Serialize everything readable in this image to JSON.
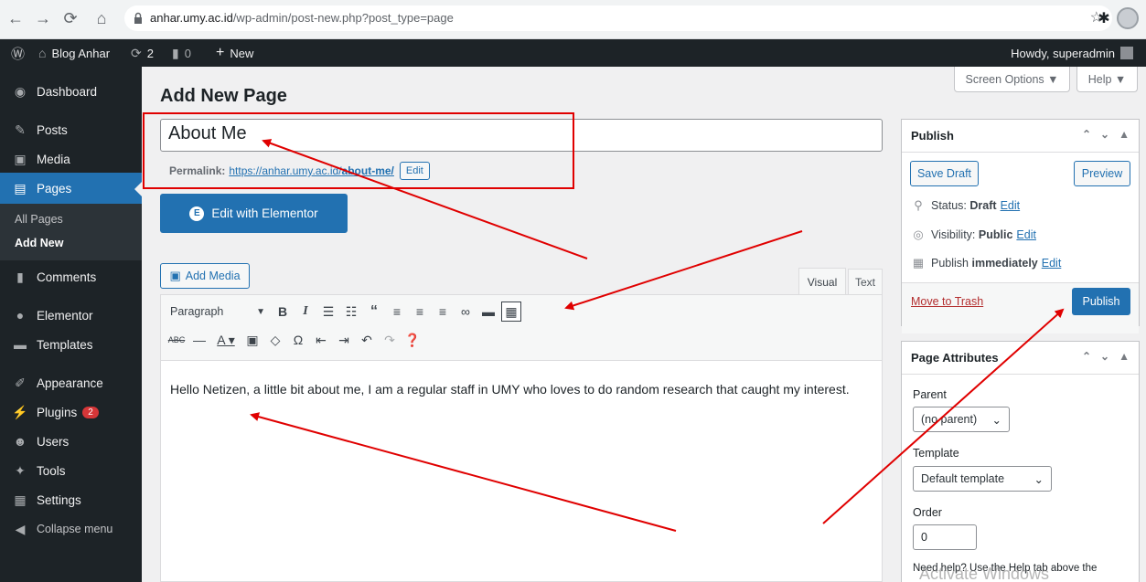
{
  "browser": {
    "url_host": "anhar.umy.ac.id",
    "url_path": "/wp-admin/post-new.php?post_type=page",
    "icons": [
      "back-icon",
      "forward-icon",
      "reload-icon",
      "home-icon",
      "lock-icon",
      "star-icon",
      "puzzle-icon",
      "profile-icon"
    ]
  },
  "adminbar": {
    "site_name": "Blog Anhar",
    "updates_count": "2",
    "comments_count": "0",
    "new_label": "New",
    "howdy": "Howdy, superadmin"
  },
  "sidebar": {
    "items": [
      {
        "label": "Dashboard",
        "icon": "dashboard-icon"
      },
      {
        "label": "Posts",
        "icon": "pin-icon"
      },
      {
        "label": "Media",
        "icon": "media-icon"
      },
      {
        "label": "Pages",
        "icon": "pages-icon"
      },
      {
        "label": "Comments",
        "icon": "comment-icon"
      },
      {
        "label": "Elementor",
        "icon": "elementor-icon"
      },
      {
        "label": "Templates",
        "icon": "folder-icon"
      },
      {
        "label": "Appearance",
        "icon": "brush-icon"
      },
      {
        "label": "Plugins",
        "icon": "plugin-icon",
        "badge": "2"
      },
      {
        "label": "Users",
        "icon": "users-icon"
      },
      {
        "label": "Tools",
        "icon": "wrench-icon"
      },
      {
        "label": "Settings",
        "icon": "settings-icon"
      },
      {
        "label": "Collapse menu",
        "icon": "collapse-icon"
      }
    ],
    "submenu": [
      "All Pages",
      "Add New"
    ]
  },
  "header": {
    "screen_options": "Screen Options ▼",
    "help": "Help ▼",
    "page_title": "Add New Page"
  },
  "editor": {
    "title_value": "About Me",
    "permalink_label": "Permalink:",
    "permalink_base": "https://anhar.umy.ac.id/",
    "permalink_slug": "about-me/",
    "edit_label": "Edit",
    "elementor_label": "Edit with Elementor",
    "add_media_label": "Add Media",
    "tab_visual": "Visual",
    "tab_text": "Text",
    "format_select": "Paragraph",
    "body_text": "Hello Netizen, a little bit about me, I am a regular staff in UMY who loves to do random research that caught my interest."
  },
  "publish": {
    "title": "Publish",
    "save_draft": "Save Draft",
    "preview": "Preview",
    "status_label": "Status:",
    "status_value": "Draft",
    "visibility_label": "Visibility:",
    "visibility_value": "Public",
    "publish_label": "Publish",
    "publish_value": "immediately",
    "edit_link": "Edit",
    "move_to_trash": "Move to Trash",
    "publish_button": "Publish"
  },
  "attributes": {
    "title": "Page Attributes",
    "parent_label": "Parent",
    "parent_value": "(no parent)",
    "template_label": "Template",
    "template_value": "Default template",
    "order_label": "Order",
    "order_value": "0",
    "help_text": "Need help? Use the Help tab above the"
  },
  "watermark": "Activate Windows",
  "colors": {
    "accent": "#2271b1",
    "annotation": "#e00000",
    "adminbar": "#1d2327"
  }
}
